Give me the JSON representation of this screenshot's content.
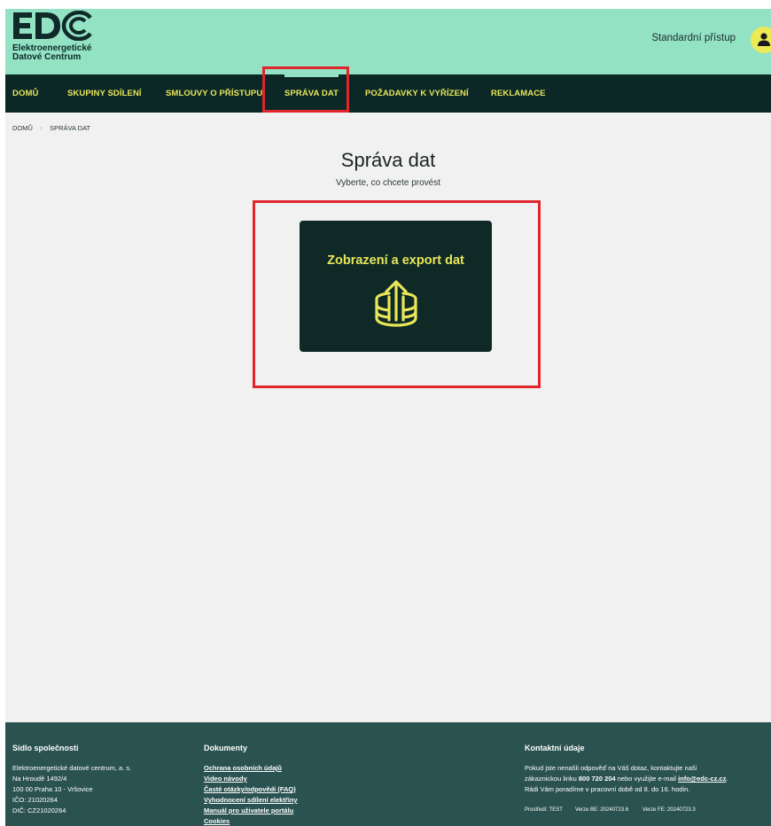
{
  "header": {
    "logo_line1": "Elektroenergetické",
    "logo_line2": "Datové Centrum",
    "access_label": "Standardní přístup"
  },
  "nav": {
    "items": [
      {
        "label": "DOMŮ"
      },
      {
        "label": "SKUPINY SDÍLENÍ"
      },
      {
        "label": "SMLOUVY O PŘÍSTUPU"
      },
      {
        "label": "SPRÁVA DAT"
      },
      {
        "label": "POŽADAVKY K VYŘÍZENÍ"
      },
      {
        "label": "REKLAMACE"
      }
    ],
    "active": "SPRÁVA DAT"
  },
  "breadcrumb": {
    "home": "DOMŮ",
    "current": "SPRÁVA DAT"
  },
  "main": {
    "title": "Správa dat",
    "subtitle": "Vyberte, co chcete provést",
    "card_label": "Zobrazení a export dat",
    "card_icon": "database-export-icon"
  },
  "footer": {
    "company": {
      "heading": "Sídlo společnosti",
      "lines": [
        "Elektroenergetické datové centrum, a. s.",
        "Na Hroudě 1492/4",
        "100 00 Praha 10 - Vršovice",
        "IČO: 21020264",
        "DIČ: CZ21020264"
      ]
    },
    "documents": {
      "heading": "Dokumenty",
      "links": [
        "Ochrana osobních údajů",
        "Video návody",
        "Časté otázky/odpovědi (FAQ)",
        "Vyhodnocení sdílení elektřiny",
        "Manuál pro uživatele portálu",
        "Cookies"
      ]
    },
    "contact": {
      "heading": "Kontaktní údaje",
      "line1": "Pokud jste nenašli odpověď na Váš dotaz, kontaktujte naši",
      "line2_prefix": "zákaznickou linku",
      "phone": "800 720 204",
      "line2_mid": "nebo využijte e-mail",
      "email": "info@edc-cz.cz",
      "line2_suffix": ".",
      "line3": "Rádi Vám poradíme v pracovní době od 8. do 16. hodin.",
      "env": "Prostředí: TEST",
      "version_be": "Verze BE: 20240723.6",
      "version_fe": "Verze FE: 20240723.3"
    }
  },
  "colors": {
    "header_bg": "#93e2c4",
    "nav_bg": "#0c2826",
    "accent_yellow": "#e9e65a",
    "footer_bg": "#2a5250",
    "highlight_red": "#e0252b"
  }
}
